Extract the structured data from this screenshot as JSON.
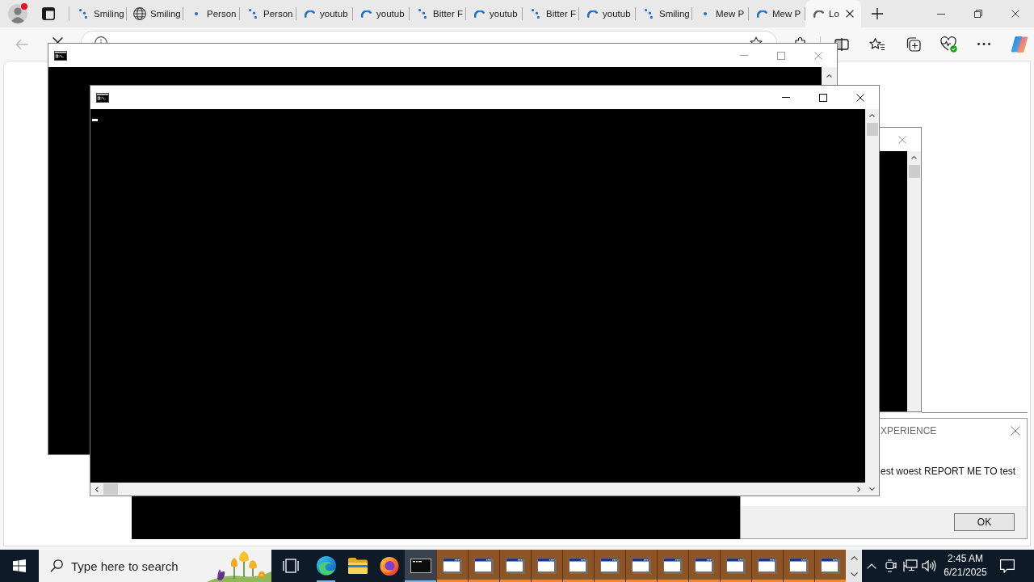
{
  "browser": {
    "profile": {
      "notification": true
    },
    "tabs": [
      {
        "kind": "dots",
        "title": "Smiling",
        "selected": false
      },
      {
        "kind": "globe",
        "title": "Smiling",
        "selected": false
      },
      {
        "kind": "dot",
        "title": "Person",
        "selected": false
      },
      {
        "kind": "dots",
        "title": "Person",
        "selected": false
      },
      {
        "kind": "arc",
        "title": "youtub",
        "selected": false
      },
      {
        "kind": "arc",
        "title": "youtub",
        "selected": false
      },
      {
        "kind": "dots",
        "title": "Bitter F",
        "selected": false
      },
      {
        "kind": "arc",
        "title": "youtub",
        "selected": false
      },
      {
        "kind": "dots",
        "title": "Bitter F",
        "selected": false
      },
      {
        "kind": "arc",
        "title": "youtub",
        "selected": false
      },
      {
        "kind": "dots",
        "title": "Smiling",
        "selected": false
      },
      {
        "kind": "dot",
        "title": "Mew P",
        "selected": false
      },
      {
        "kind": "arc",
        "title": "Mew P",
        "selected": false
      },
      {
        "kind": "arc",
        "title": "Lo",
        "selected": true
      }
    ],
    "toolbar": {
      "back_disabled": true
    }
  },
  "windows": [
    {
      "kind": "body"
    },
    {
      "kind": "strip",
      "active": false
    },
    {
      "kind": "behind",
      "active": false
    },
    {
      "kind": "full",
      "active": true,
      "cursor": true
    }
  ],
  "dialog": {
    "title": "XPERIENCE",
    "message": "est woest REPORT ME TO test",
    "button": "OK"
  },
  "taskbar": {
    "search": {
      "placeholder": "Type here to search"
    },
    "apps": [
      {
        "kind": "edge",
        "running": true,
        "selected": false,
        "flashing": false
      },
      {
        "kind": "explorer",
        "running": false,
        "selected": false,
        "flashing": false
      },
      {
        "kind": "firefox",
        "running": false,
        "selected": false,
        "flashing": false
      },
      {
        "kind": "console",
        "running": true,
        "selected": true,
        "flashing": false
      },
      {
        "kind": "window",
        "running": true,
        "selected": false,
        "flashing": true
      },
      {
        "kind": "window",
        "running": true,
        "selected": false,
        "flashing": true
      },
      {
        "kind": "window",
        "running": true,
        "selected": false,
        "flashing": true
      },
      {
        "kind": "window",
        "running": true,
        "selected": false,
        "flashing": true
      },
      {
        "kind": "window",
        "running": true,
        "selected": false,
        "flashing": true
      },
      {
        "kind": "window",
        "running": true,
        "selected": false,
        "flashing": true
      },
      {
        "kind": "window",
        "running": true,
        "selected": false,
        "flashing": true
      },
      {
        "kind": "window",
        "running": true,
        "selected": false,
        "flashing": true
      },
      {
        "kind": "window",
        "running": true,
        "selected": false,
        "flashing": true
      },
      {
        "kind": "window",
        "running": true,
        "selected": false,
        "flashing": true
      },
      {
        "kind": "window",
        "running": true,
        "selected": false,
        "flashing": true
      },
      {
        "kind": "window",
        "running": true,
        "selected": false,
        "flashing": true
      },
      {
        "kind": "window",
        "running": true,
        "selected": false,
        "flashing": true
      }
    ],
    "clock": {
      "time": "2:45 AM",
      "date": "6/21/2025"
    }
  }
}
